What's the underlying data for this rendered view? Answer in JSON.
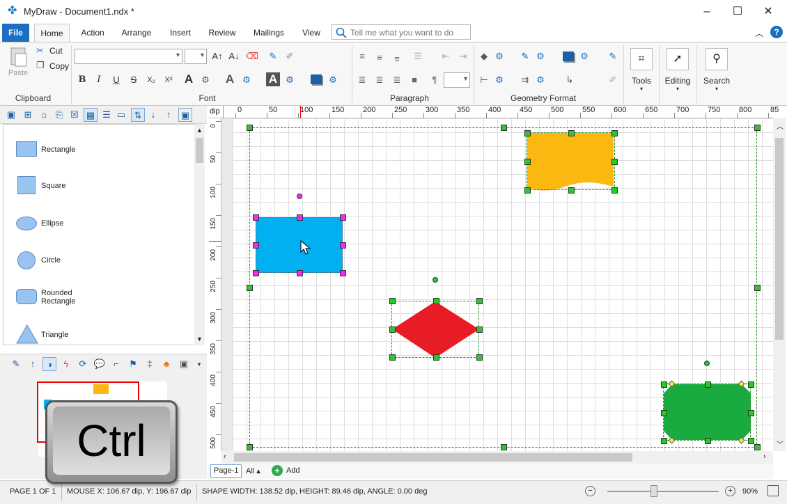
{
  "titlebar": {
    "title": "MyDraw - Document1.ndx *",
    "minimize": "–",
    "maximize": "☐",
    "close": "✕"
  },
  "tabs": [
    "File",
    "Home",
    "Action",
    "Arrange",
    "Insert",
    "Review",
    "Mailings",
    "View"
  ],
  "tell_me": {
    "placeholder": "Tell me what you want to do"
  },
  "ribbon": {
    "clipboard": {
      "paste": "Paste",
      "cut": "Cut",
      "copy": "Copy",
      "label": "Clipboard"
    },
    "font": {
      "label": "Font",
      "bold": "B",
      "italic": "I",
      "underline": "U",
      "strike": "S",
      "sub": "X₂",
      "sup": "X²"
    },
    "paragraph": {
      "label": "Paragraph",
      "pilcrow": "¶"
    },
    "geometry": {
      "label": "Geometry Format"
    },
    "tools": {
      "label": "Tools"
    },
    "editing": {
      "label": "Editing"
    },
    "search": {
      "label": "Search"
    }
  },
  "shapes_panel": {
    "items": [
      "Rectangle",
      "Square",
      "Ellipse",
      "Circle",
      "Rounded\nRectangle",
      "Triangle"
    ]
  },
  "ruler": {
    "unit": "dip",
    "h_ticks": [
      "0",
      "50",
      "100",
      "150",
      "200",
      "250",
      "300",
      "350",
      "400",
      "450",
      "500",
      "550",
      "600",
      "650",
      "700",
      "750",
      "800",
      "85"
    ],
    "v_ticks": [
      "0",
      "50",
      "100",
      "150",
      "200",
      "250",
      "300",
      "350",
      "400",
      "450",
      "500"
    ]
  },
  "page_tabs": {
    "page": "Page-1",
    "all": "All ▴",
    "add": "Add"
  },
  "status": {
    "page": "PAGE 1 OF 1",
    "mouse": "MOUSE X: 106.67 dip, Y: 196.67 dip",
    "shape": "SHAPE WIDTH: 138.52 dip, HEIGHT: 89.46 dip, ANGLE: 0.00 deg",
    "zoom": "90%"
  },
  "overlay": {
    "key": "Ctrl"
  },
  "colors": {
    "accent": "#1b6ec2",
    "blue_shape": "#00b0f0",
    "yellow_shape": "#fbb811",
    "red_shape": "#e81c24",
    "green_shape": "#1aab40"
  }
}
